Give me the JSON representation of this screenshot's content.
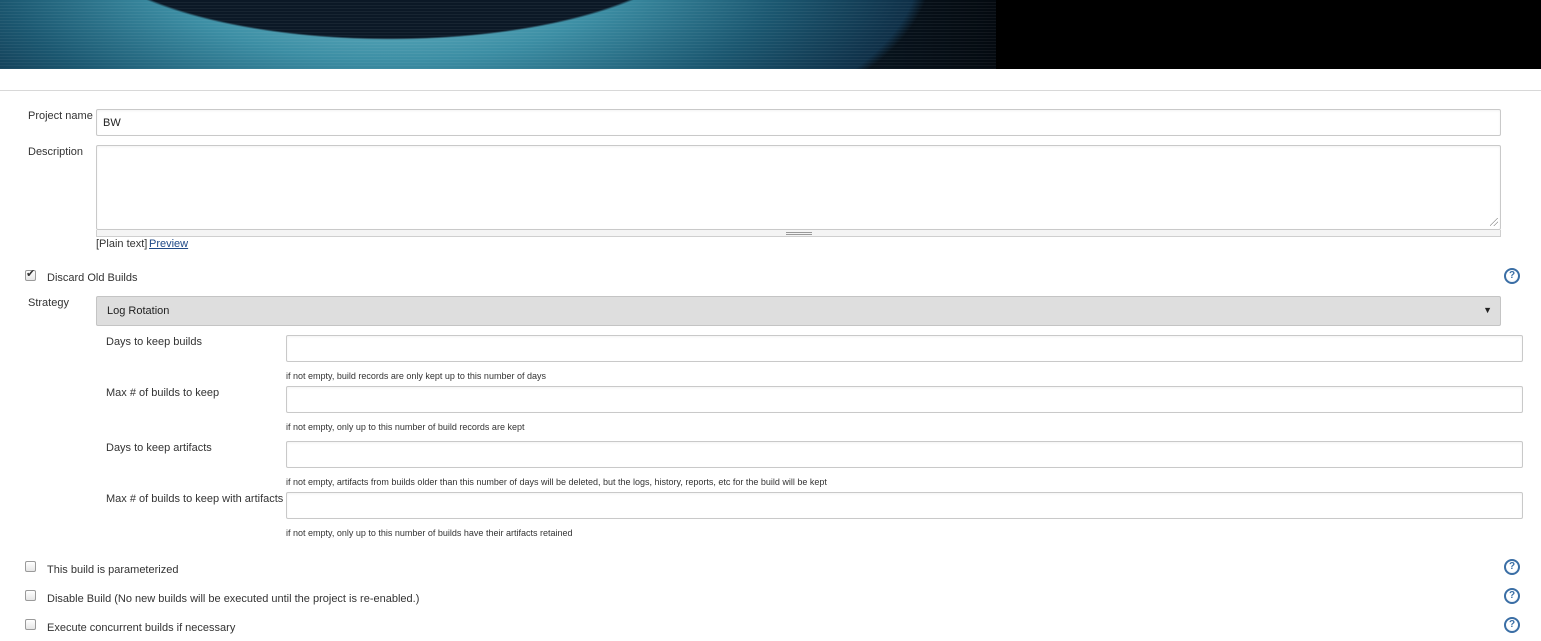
{
  "form": {
    "project_name": {
      "label": "Project name",
      "value": "BW"
    },
    "description": {
      "label": "Description",
      "value": "",
      "format": "[Plain text]",
      "preview_link": "Preview"
    },
    "discard_old_builds": {
      "label": "Discard Old Builds",
      "checked": true
    },
    "strategy": {
      "label": "Strategy",
      "selected": "Log Rotation",
      "fields": [
        {
          "label": "Days to keep builds",
          "value": "",
          "hint": "if not empty, build records are only kept up to this number of days"
        },
        {
          "label": "Max # of builds to keep",
          "value": "",
          "hint": "if not empty, only up to this number of build records are kept"
        },
        {
          "label": "Days to keep artifacts",
          "value": "",
          "hint": "if not empty, artifacts from builds older than this number of days will be deleted, but the logs, history, reports, etc for the build will be kept"
        },
        {
          "label": "Max # of builds to keep with artifacts",
          "value": "",
          "hint": "if not empty, only up to this number of builds have their artifacts retained"
        }
      ]
    },
    "options": [
      {
        "label": "This build is parameterized",
        "checked": false
      },
      {
        "label": "Disable Build (No new builds will be executed until the project is re-enabled.)",
        "checked": false
      },
      {
        "label": "Execute concurrent builds if necessary",
        "checked": false
      }
    ],
    "help_symbol": "?"
  },
  "icons": {
    "help": "help-question-icon",
    "dropdown": "chevron-down-icon",
    "checkbox": "checkbox-icon"
  }
}
